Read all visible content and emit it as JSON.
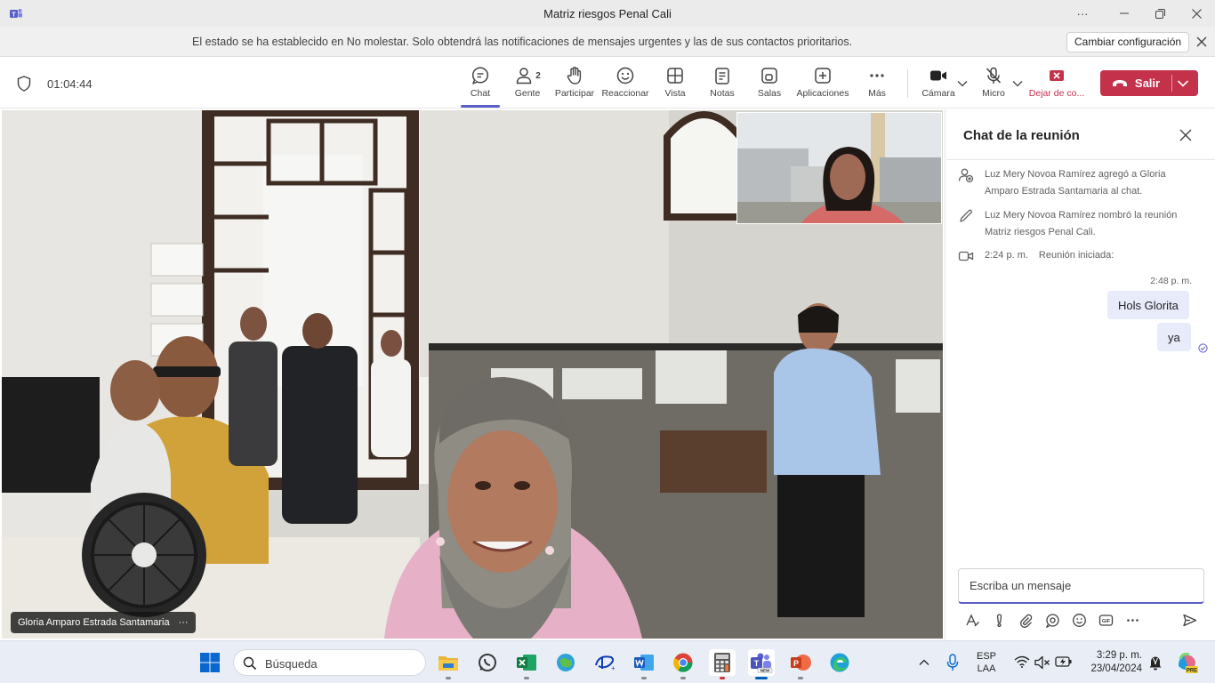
{
  "window": {
    "title": "Matriz riesgos Penal Cali",
    "controls": [
      "more-options-icon",
      "minimize-icon",
      "restore-icon",
      "close-icon"
    ]
  },
  "notification": {
    "text": "El estado se ha establecido en No molestar. Solo obtendrá las notificaciones de mensajes urgentes y las de sus contactos prioritarios.",
    "button": "Cambiar configuración"
  },
  "toolbar": {
    "timer": "01:04:44",
    "chat": "Chat",
    "people": "Gente",
    "people_count": "2",
    "raise": "Participar",
    "react": "Reaccionar",
    "view": "Vista",
    "notes": "Notas",
    "rooms": "Salas",
    "apps": "Aplicaciones",
    "more": "Más",
    "camera": "Cámara",
    "mic": "Micro",
    "stop_share": "Dejar de co...",
    "leave": "Salir",
    "active_color": "#5b5fc7",
    "leave_color": "#c4314b"
  },
  "stage": {
    "main_participant": "Gloria Amparo Estrada Santamaria",
    "more": "···"
  },
  "chat": {
    "title": "Chat de la reunión",
    "events": [
      {
        "icon": "people-add-icon",
        "text": "Luz Mery Novoa Ramírez agregó a Gloria Amparo Estrada Santamaria al chat."
      },
      {
        "icon": "pencil-icon",
        "text": "Luz Mery Novoa Ramírez nombró la reunión Matriz riesgos Penal Cali."
      },
      {
        "icon": "video-icon",
        "time": "2:24 p. m.",
        "text": "Reunión iniciada:"
      }
    ],
    "message_time": "2:48 p. m.",
    "messages": [
      "Hols Glorita",
      "ya"
    ],
    "compose_placeholder": "Escriba un mensaje"
  },
  "taskbar": {
    "search": "Búsqueda",
    "lang_1": "ESP",
    "lang_2": "LAA",
    "time": "3:29 p. m.",
    "date": "23/04/2024",
    "apps": [
      "file-explorer-icon",
      "whatsapp-icon",
      "excel-icon",
      "widget-icon",
      "disney-plus-icon",
      "word-icon",
      "chrome-icon",
      "calculator-icon",
      "teams-icon",
      "powerpoint-icon",
      "edge-icon"
    ]
  }
}
